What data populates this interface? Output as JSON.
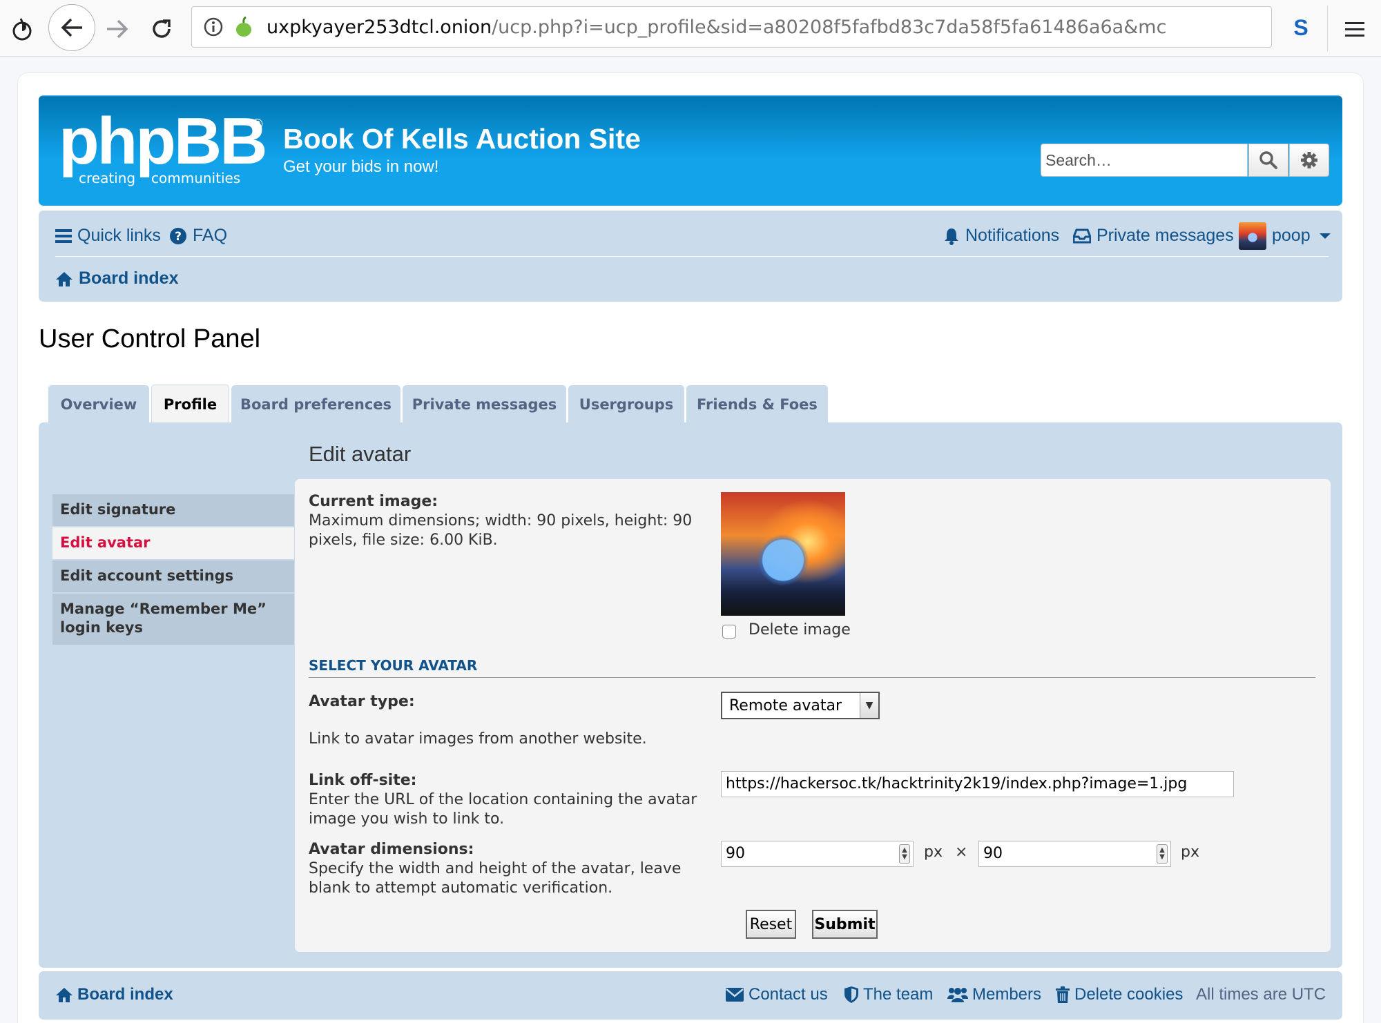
{
  "browser": {
    "url_host": "uxpkyayer253dtcl.onion",
    "url_path": "/ucp.php?i=ucp_profile&sid=a80208f5fafbd83c7da58f5fa61486a6a&mc"
  },
  "header": {
    "logo_text": "phpBB",
    "logo_registered": "®",
    "logo_tagline_left": "creating",
    "logo_tagline_right": "communities",
    "site_title": "Book Of Kells Auction Site",
    "site_description": "Get your bids in now!",
    "search_placeholder": "Search…"
  },
  "navbar": {
    "quick_links": "Quick links",
    "faq": "FAQ",
    "notifications": "Notifications",
    "private_messages": "Private messages",
    "username": "poop",
    "board_index": "Board index"
  },
  "page_title": "User Control Panel",
  "tabs": [
    {
      "label": "Overview"
    },
    {
      "label": "Profile"
    },
    {
      "label": "Board preferences"
    },
    {
      "label": "Private messages"
    },
    {
      "label": "Usergroups"
    },
    {
      "label": "Friends & Foes"
    }
  ],
  "sidenav": [
    {
      "label": "Edit signature"
    },
    {
      "label": "Edit avatar"
    },
    {
      "label": "Edit account settings"
    },
    {
      "label": "Manage “Remember Me” login keys"
    }
  ],
  "panel": {
    "title": "Edit avatar",
    "current_image_label": "Current image:",
    "current_image_explain": "Maximum dimensions; width: 90 pixels, height: 90 pixels, file size: 6.00 KiB.",
    "delete_image_label": "Delete image",
    "select_legend": "SELECT YOUR AVATAR",
    "avatar_type_label": "Avatar type:",
    "avatar_type_value": "Remote avatar",
    "avatar_type_explain": "Link to avatar images from another website.",
    "link_label": "Link off-site:",
    "link_explain": "Enter the URL of the location containing the avatar image you wish to link to.",
    "link_value": "https://hackersoc.tk/hacktrinity2k19/index.php?image=1.jpg",
    "dimensions_label": "Avatar dimensions:",
    "dimensions_explain": "Specify the width and height of the avatar, leave blank to attempt automatic verification.",
    "width_value": "90",
    "height_value": "90",
    "unit": "px",
    "times": "×",
    "reset_button": "Reset",
    "submit_button": "Submit"
  },
  "footer": {
    "board_index": "Board index",
    "contact_us": "Contact us",
    "the_team": "The team",
    "members": "Members",
    "delete_cookies": "Delete cookies",
    "timezone": "All times are UTC"
  }
}
